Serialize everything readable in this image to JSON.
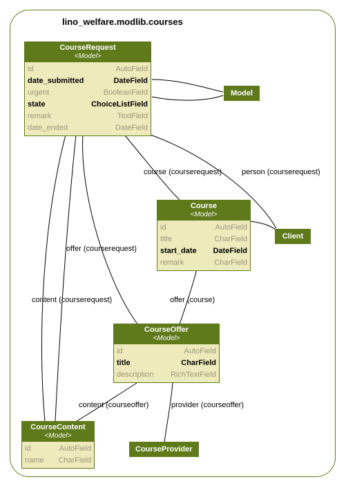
{
  "package": {
    "title": "lino_welfare.modlib.courses"
  },
  "classes": {
    "courserequest": {
      "name": "CourseRequest",
      "stereotype": "<Model>",
      "attrs": [
        {
          "name": "id",
          "type": "AutoField",
          "emph": "dim"
        },
        {
          "name": "date_submitted",
          "type": "DateField",
          "emph": "bold"
        },
        {
          "name": "urgent",
          "type": "BooleanField",
          "emph": "dim"
        },
        {
          "name": "state",
          "type": "ChoiceListField",
          "emph": "bold"
        },
        {
          "name": "remark",
          "type": "TextField",
          "emph": "dim"
        },
        {
          "name": "date_ended",
          "type": "DateField",
          "emph": "dim"
        }
      ]
    },
    "course": {
      "name": "Course",
      "stereotype": "<Model>",
      "attrs": [
        {
          "name": "id",
          "type": "AutoField",
          "emph": "dim"
        },
        {
          "name": "title",
          "type": "CharField",
          "emph": "dim"
        },
        {
          "name": "start_date",
          "type": "DateField",
          "emph": "bold"
        },
        {
          "name": "remark",
          "type": "CharField",
          "emph": "dim"
        }
      ]
    },
    "courseoffer": {
      "name": "CourseOffer",
      "stereotype": "<Model>",
      "attrs": [
        {
          "name": "id",
          "type": "AutoField",
          "emph": "dim"
        },
        {
          "name": "title",
          "type": "CharField",
          "emph": "bold"
        },
        {
          "name": "description",
          "type": "RichTextField",
          "emph": "dim"
        }
      ]
    },
    "coursecontent": {
      "name": "CourseContent",
      "stereotype": "<Model>",
      "attrs": [
        {
          "name": "id",
          "type": "AutoField",
          "emph": "dim"
        },
        {
          "name": "name",
          "type": "CharField",
          "emph": "dim"
        }
      ]
    }
  },
  "simple": {
    "model": {
      "label": "Model"
    },
    "client": {
      "label": "Client"
    },
    "courseprovider": {
      "label": "CourseProvider"
    }
  },
  "edges": {
    "course_req": "course (courserequest)",
    "person_req": "person (courserequest)",
    "offer_req": "offer (courserequest)",
    "content_req": "content (courserequest)",
    "offer_course": "offer (course)",
    "content_offer": "content (courseoffer)",
    "provider_offer": "provider (courseoffer)"
  }
}
